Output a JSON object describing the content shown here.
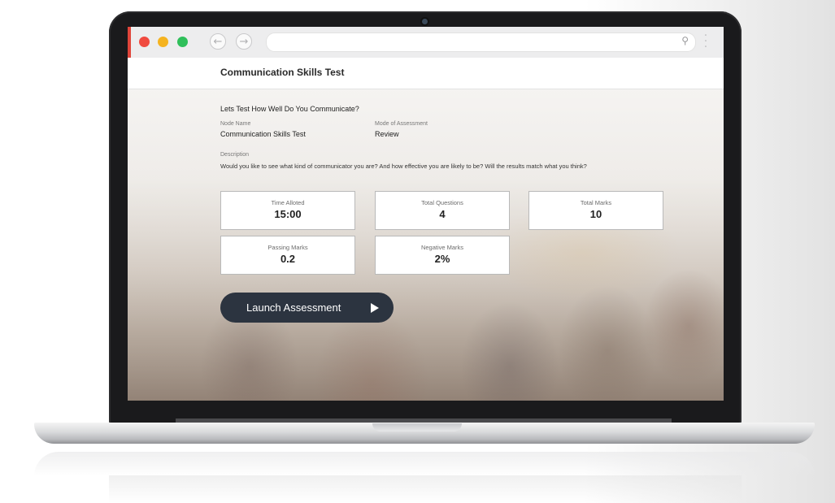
{
  "app": {
    "title": "Communication Skills Test"
  },
  "browser": {
    "url": "",
    "back_icon": "arrow-left-icon",
    "forward_icon": "arrow-right-icon",
    "search_icon": "search-icon",
    "menu_icon": "kebab-menu-icon",
    "traffic_lights": [
      "#f04a3f",
      "#f5b31f",
      "#2fbf5a"
    ]
  },
  "assessment": {
    "headline": "Lets Test How Well Do You Communicate?",
    "node_name_label": "Node Name",
    "node_name_value": "Communication Skills Test",
    "mode_label": "Mode of Assessment",
    "mode_value": "Review",
    "description_label": "Description",
    "description_text": "Would you like to see what kind of communicator you are? And how effective you are likely to be? Will the results match what you think?",
    "stats": [
      {
        "label": "Time Alloted",
        "value": "15:00"
      },
      {
        "label": "Total Questions",
        "value": "4"
      },
      {
        "label": "Total Marks",
        "value": "10"
      },
      {
        "label": "Passing Marks",
        "value": "0.2"
      },
      {
        "label": "Negative Marks",
        "value": "2%"
      }
    ],
    "launch_label": "Launch Assessment",
    "launch_icon": "play-icon"
  },
  "colors": {
    "button_bg": "#2c3440",
    "accent_red": "#e0453a"
  }
}
